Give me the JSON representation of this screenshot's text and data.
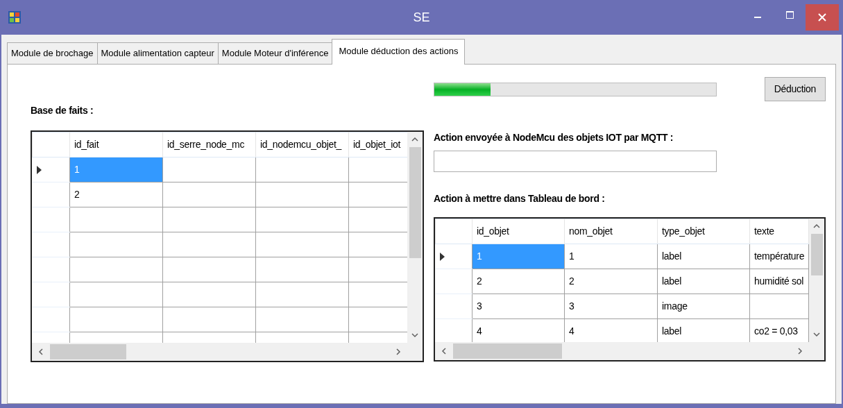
{
  "window": {
    "title": "SE"
  },
  "tabs": [
    {
      "label": "Module de brochage",
      "selected": false
    },
    {
      "label": "Module alimentation capteur",
      "selected": false
    },
    {
      "label": "Module Moteur d'inférence",
      "selected": false
    },
    {
      "label": "Module déduction des actions",
      "selected": true
    }
  ],
  "progress": {
    "level": 0.2
  },
  "deduction_button": "Déduction",
  "facts": {
    "label": "Base de faits :",
    "columns": [
      "id_fait",
      "id_serre_node_mc",
      "id_nodemcu_objet_",
      "id_objet_iot"
    ],
    "rows": [
      {
        "selected": true,
        "cells": [
          "1"
        ]
      },
      {
        "selected": false,
        "cells": [
          "2"
        ]
      }
    ]
  },
  "mqtt": {
    "label": "Action envoyée à NodeMcu des objets IOT par MQTT :"
  },
  "dashboard": {
    "label": "Action à mettre dans Tableau de bord :",
    "columns": [
      "id_objet",
      "nom_objet",
      "type_objet",
      "texte"
    ],
    "rows": [
      {
        "selected": true,
        "cells": [
          "1",
          "1",
          "label",
          "température"
        ]
      },
      {
        "selected": false,
        "cells": [
          "2",
          "2",
          "label",
          "humidité sol"
        ]
      },
      {
        "selected": false,
        "cells": [
          "3",
          "3",
          "image"
        ]
      },
      {
        "selected": false,
        "cells": [
          "4",
          "4",
          "label",
          "co2 = 0,03"
        ]
      }
    ]
  }
}
